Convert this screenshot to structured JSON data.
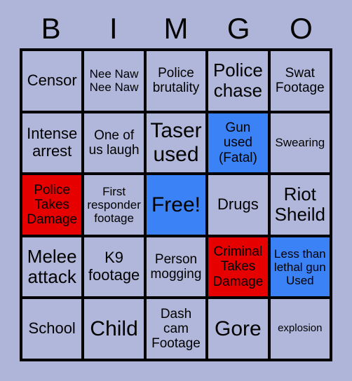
{
  "header": {
    "letters": [
      "B",
      "I",
      "M",
      "G",
      "O"
    ]
  },
  "colors": {
    "background": "#aeb5d9",
    "cell_default": "#b0b7da",
    "marked_blue": "#3b82f6",
    "marked_red": "#e60000",
    "grid_line": "#000000",
    "text": "#000000"
  },
  "grid": {
    "rows": 5,
    "columns": 5,
    "cells": [
      {
        "label": "Censor",
        "state": "default",
        "size": "lg"
      },
      {
        "label": "Nee Naw Nee Naw",
        "state": "default",
        "size": "sm"
      },
      {
        "label": "Police brutality",
        "state": "default",
        "size": "md"
      },
      {
        "label": "Police chase",
        "state": "default",
        "size": "xl"
      },
      {
        "label": "Swat Footage",
        "state": "default",
        "size": "md"
      },
      {
        "label": "Intense arrest",
        "state": "default",
        "size": "lg"
      },
      {
        "label": "One of us laugh",
        "state": "default",
        "size": "md"
      },
      {
        "label": "Taser used",
        "state": "default",
        "size": "xxl"
      },
      {
        "label": "Gun used (Fatal)",
        "state": "blue",
        "size": "md"
      },
      {
        "label": "Swearing",
        "state": "default",
        "size": "sm"
      },
      {
        "label": "Police Takes Damage",
        "state": "red",
        "size": "md"
      },
      {
        "label": "First responder footage",
        "state": "default",
        "size": "sm"
      },
      {
        "label": "Free!",
        "state": "blue",
        "size": "xxl"
      },
      {
        "label": "Drugs",
        "state": "default",
        "size": "lg"
      },
      {
        "label": "Riot Sheild",
        "state": "default",
        "size": "xl"
      },
      {
        "label": "Melee attack",
        "state": "default",
        "size": "xl"
      },
      {
        "label": "K9 footage",
        "state": "default",
        "size": "lg"
      },
      {
        "label": "Person mogging",
        "state": "default",
        "size": "md"
      },
      {
        "label": "Criminal Takes Damage",
        "state": "red",
        "size": "md"
      },
      {
        "label": "Less than lethal gun Used",
        "state": "blue",
        "size": "sm"
      },
      {
        "label": "School",
        "state": "default",
        "size": "lg"
      },
      {
        "label": "Child",
        "state": "default",
        "size": "xxl"
      },
      {
        "label": "Dash cam Footage",
        "state": "default",
        "size": "md"
      },
      {
        "label": "Gore",
        "state": "default",
        "size": "xxl"
      },
      {
        "label": "explosion",
        "state": "default",
        "size": "xs"
      }
    ]
  }
}
